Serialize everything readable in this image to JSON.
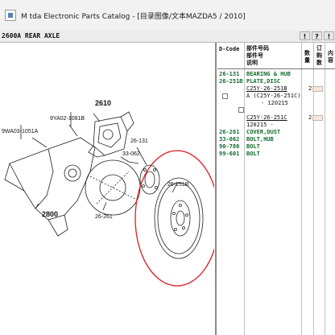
{
  "window": {
    "title": "M  tda Electronic Parts Catalog - [目录图像/文本MAZDA5 / 2010]"
  },
  "toolbar": {
    "assembly_label": "2600A  REAR AXLE",
    "buttons": [
      "!",
      "?",
      "!"
    ]
  },
  "diagram": {
    "callouts": {
      "c2610": "2610",
      "c9ya02": "9YA02-1081B",
      "c9wa03": "9WA03-1051A",
      "c26131": "26-131",
      "c33062": "33-062",
      "c26261": "26-261",
      "c26251b": "26-251B",
      "c2800": "2800"
    },
    "highlight_color": "#e01b22"
  },
  "parts_list": {
    "headers": {
      "code": "D-Code",
      "desc": [
        "部件号码",
        "部件号",
        "说明"
      ],
      "qty": [
        "数",
        "量"
      ],
      "order": [
        "订",
        "购",
        "数"
      ],
      "extra": [
        "内",
        "容"
      ]
    },
    "rows": [
      {
        "code": "26-131",
        "desc": "BEARING & HUB"
      },
      {
        "code": "26-251B",
        "desc": "PLATE,DISC"
      },
      {
        "code": "26-261",
        "desc": "COVER,DUST"
      },
      {
        "code": "33-062",
        "desc": "BOLT,HUB"
      },
      {
        "code": "90-780",
        "desc": "BOLT"
      },
      {
        "code": "99-601",
        "desc": "BOLT"
      }
    ],
    "sub1": {
      "part": "C25Y-26-251B",
      "alt": "A (C25Y-26-251C)",
      "date": "- 120215",
      "qty": "2"
    },
    "sub2": {
      "part": "C25Y-26-251C",
      "date": "120215   -",
      "qty": "2"
    },
    "text_color": "#0f6b2c"
  }
}
